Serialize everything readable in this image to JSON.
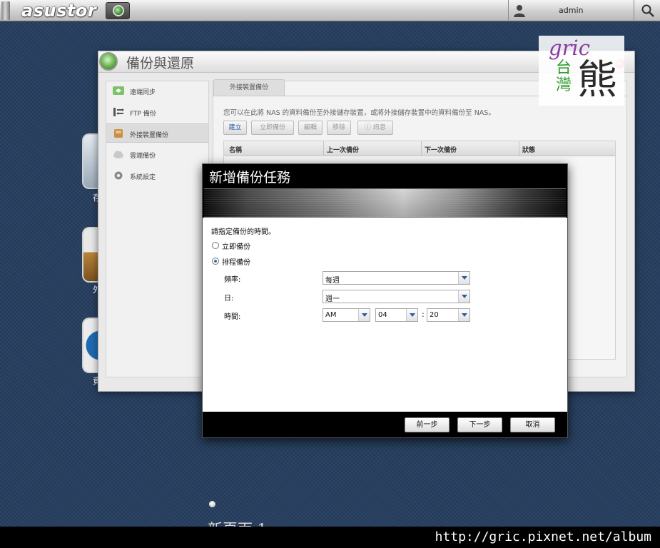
{
  "topbar": {
    "logo_text": "asustor",
    "username": "admin"
  },
  "desktop": {
    "icons": [
      {
        "label": "存",
        "color": "#b9c7d6"
      },
      {
        "label": "外",
        "color": "#c08a3e"
      },
      {
        "label": "資",
        "color": "#2a6fb0"
      }
    ],
    "page_label": "新頁面 1"
  },
  "window": {
    "title": "備份與還原",
    "nav_items": [
      {
        "label": "遠端同步",
        "icon": "sync-icon"
      },
      {
        "label": "FTP 備份",
        "icon": "ftp-icon"
      },
      {
        "label": "外接裝置備份",
        "icon": "external-drive-icon"
      },
      {
        "label": "雲端備份",
        "icon": "cloud-icon"
      },
      {
        "label": "系統設定",
        "icon": "gear-icon"
      }
    ],
    "active_nav_index": 2,
    "tab_label": "外接裝置備份",
    "description": "您可以在此將 NAS 的資料備份至外接儲存裝置，或將外接儲存裝置中的資料備份至 NAS。",
    "toolbar": {
      "create": "建立",
      "backup_now": "立即備份",
      "edit": "編輯",
      "remove": "移除",
      "info": "訊息"
    },
    "columns": [
      "名稱",
      "上一次備份",
      "下一次備份",
      "狀態"
    ]
  },
  "watermark": {
    "gric": "gric",
    "tw1": "台",
    "tw2": "灣",
    "bear": "熊"
  },
  "dialog": {
    "title": "新增備份任務",
    "prompt": "請指定備份的時間。",
    "options": [
      {
        "label": "立即備份",
        "selected": false
      },
      {
        "label": "排程備份",
        "selected": true
      }
    ],
    "frequency_label": "頻率:",
    "frequency_value": "每週",
    "day_label": "日:",
    "day_value": "週一",
    "time_label": "時間:",
    "time_ampm": "AM",
    "time_hour": "04",
    "time_separator": ":",
    "time_minute": "20",
    "buttons": {
      "back": "前一步",
      "next": "下一步",
      "cancel": "取消"
    }
  },
  "footer_url": "http://gric.pixnet.net/album"
}
